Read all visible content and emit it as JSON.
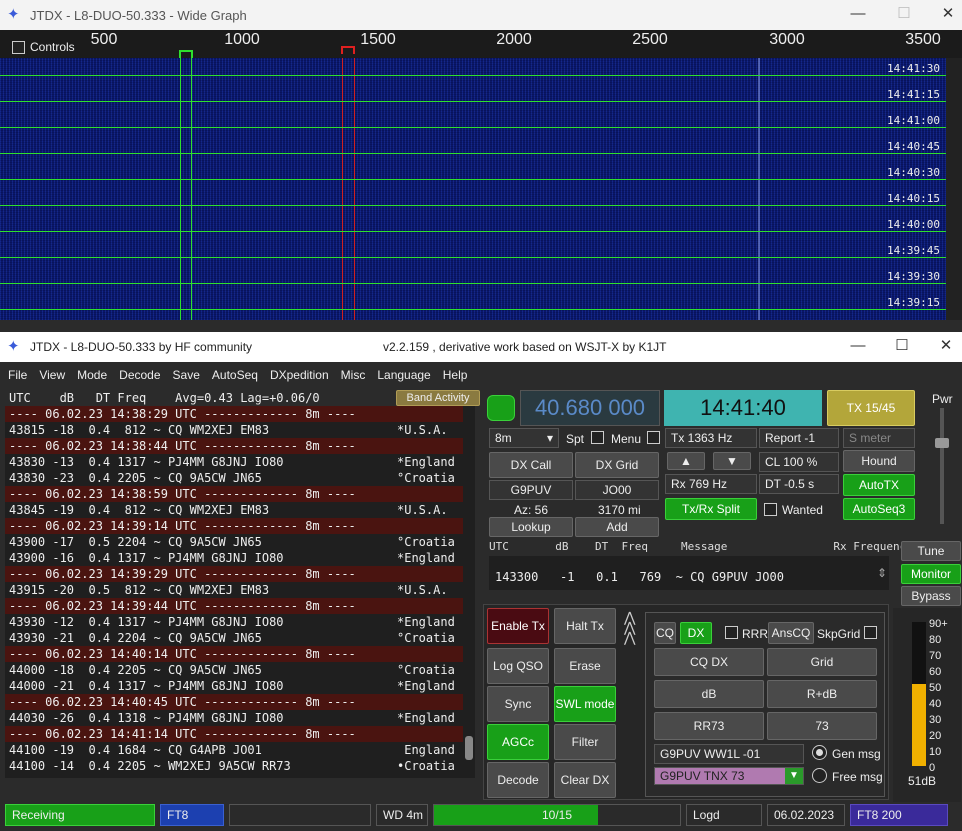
{
  "wide_graph": {
    "title": "JTDX - L8-DUO-50.333 - Wide Graph",
    "controls_label": "Controls",
    "ruler": [
      "500",
      "1000",
      "1500",
      "2000",
      "2500",
      "3000",
      "3500"
    ],
    "times": [
      "14:41:30",
      "14:41:15",
      "14:41:00",
      "14:40:45",
      "14:40:30",
      "14:40:15",
      "14:40:00",
      "14:39:45",
      "14:39:30",
      "14:39:15"
    ]
  },
  "main": {
    "title_left": "JTDX - L8-DUO-50.333  by HF community",
    "title_right": "v2.2.159 , derivative work based on WSJT-X by K1JT"
  },
  "menu": [
    "File",
    "View",
    "Mode",
    "Decode",
    "Save",
    "AutoSeq",
    "DXpedition",
    "Misc",
    "Language",
    "Help"
  ],
  "decode": {
    "header": "UTC    dB   DT Freq    Avg=0.43 Lag=+0.06/0",
    "band_activity": "Band Activity",
    "lines": [
      {
        "t": "---- 06.02.23 14:38:29 UTC ------------- 8m ----",
        "sep": true
      },
      {
        "t": "43815 -18  0.4  812 ~ CQ WM2XEJ EM83",
        "c": "*U.S.A."
      },
      {
        "t": "---- 06.02.23 14:38:44 UTC ------------- 8m ----",
        "sep": true
      },
      {
        "t": "43830 -13  0.4 1317 ~ PJ4MM G8JNJ IO80",
        "c": "*England"
      },
      {
        "t": "43830 -23  0.4 2205 ~ CQ 9A5CW JN65",
        "c": "°Croatia"
      },
      {
        "t": "---- 06.02.23 14:38:59 UTC ------------- 8m ----",
        "sep": true
      },
      {
        "t": "43845 -19  0.4  812 ~ CQ WM2XEJ EM83",
        "c": "*U.S.A."
      },
      {
        "t": "---- 06.02.23 14:39:14 UTC ------------- 8m ----",
        "sep": true
      },
      {
        "t": "43900 -17  0.5 2204 ~ CQ 9A5CW JN65",
        "c": "°Croatia"
      },
      {
        "t": "43900 -16  0.4 1317 ~ PJ4MM G8JNJ IO80",
        "c": "*England"
      },
      {
        "t": "---- 06.02.23 14:39:29 UTC ------------- 8m ----",
        "sep": true
      },
      {
        "t": "43915 -20  0.5  812 ~ CQ WM2XEJ EM83",
        "c": "*U.S.A."
      },
      {
        "t": "---- 06.02.23 14:39:44 UTC ------------- 8m ----",
        "sep": true
      },
      {
        "t": "43930 -12  0.4 1317 ~ PJ4MM G8JNJ IO80",
        "c": "*England"
      },
      {
        "t": "43930 -21  0.4 2204 ~ CQ 9A5CW JN65",
        "c": "°Croatia"
      },
      {
        "t": "---- 06.02.23 14:40:14 UTC ------------- 8m ----",
        "sep": true
      },
      {
        "t": "44000 -18  0.4 2205 ~ CQ 9A5CW JN65",
        "c": "°Croatia"
      },
      {
        "t": "44000 -21  0.4 1317 ~ PJ4MM G8JNJ IO80",
        "c": "*England"
      },
      {
        "t": "---- 06.02.23 14:40:45 UTC ------------- 8m ----",
        "sep": true
      },
      {
        "t": "44030 -26  0.4 1318 ~ PJ4MM G8JNJ IO80",
        "c": "*England"
      },
      {
        "t": "---- 06.02.23 14:41:14 UTC ------------- 8m ----",
        "sep": true
      },
      {
        "t": "44100 -19  0.4 1684 ~ CQ G4APB JO01",
        "c": " England"
      },
      {
        "t": "44100 -14  0.4 2205 ~ WM2XEJ 9A5CW RR73",
        "c": "•Croatia"
      }
    ]
  },
  "freq": "40.680 000",
  "clock": "14:41:40",
  "tx_badge": "TX 15/45",
  "pwr": "Pwr",
  "band": "8m",
  "spt": "Spt",
  "menu_label": "Menu",
  "tx_hz": "Tx  1363  Hz",
  "report": "Report -1",
  "smeter": "S meter",
  "dx_call_btn": "DX Call",
  "dx_grid_btn": "DX Grid",
  "dx_call": "G9PUV",
  "dx_grid": "JO00",
  "cl": "CL  100 %",
  "hound": "Hound",
  "az": "Az: 56",
  "dist": "3170 mi",
  "rx_hz": "Rx  769  Hz",
  "dt": "DT -0.5 s",
  "autotx": "AutoTX",
  "lookup": "Lookup",
  "add": "Add",
  "split": "Tx/Rx Split",
  "wanted": "Wanted",
  "autoseq3": "AutoSeq3",
  "rx_header": "UTC       dB    DT  Freq     Message                Rx Frequency",
  "rx_lines": [
    "143300   -1   0.1   769  ~ CQ G9PUV JO00"
  ],
  "tune": "Tune",
  "monitor": "Monitor",
  "bypass": "Bypass",
  "enable_tx": "Enable Tx",
  "halt_tx": "Halt Tx",
  "log_qso": "Log QSO",
  "erase": "Erase",
  "sync": "Sync",
  "swl": "SWL mode",
  "agcc": "AGCc",
  "filter": "Filter",
  "decode_btn": "Decode",
  "clear_dx": "Clear DX",
  "cq": "CQ",
  "dx": "DX",
  "rrr": "RRR",
  "anscq": "AnsCQ",
  "skpgrid": "SkpGrid",
  "cq_dx": "CQ DX",
  "grid": "Grid",
  "db": "dB",
  "rdb": "R+dB",
  "rr73": "RR73",
  "s73": "73",
  "msg_text": "G9PUV WW1L -01",
  "free_text": "G9PUV TNX 73",
  "gen_msg": "Gen msg",
  "free_msg": "Free msg",
  "meter_ticks": [
    "90+",
    "80",
    "70",
    "60",
    "50",
    "40",
    "30",
    "20",
    "10",
    "0"
  ],
  "meter_db": "51dB",
  "meter_level": 51,
  "status": {
    "receiving": "Receiving",
    "mode": "FT8",
    "wd": "WD 4m",
    "progress": "10/15",
    "logd": "Logd",
    "date": "06.02.2023",
    "ft8_200": "FT8  200"
  }
}
